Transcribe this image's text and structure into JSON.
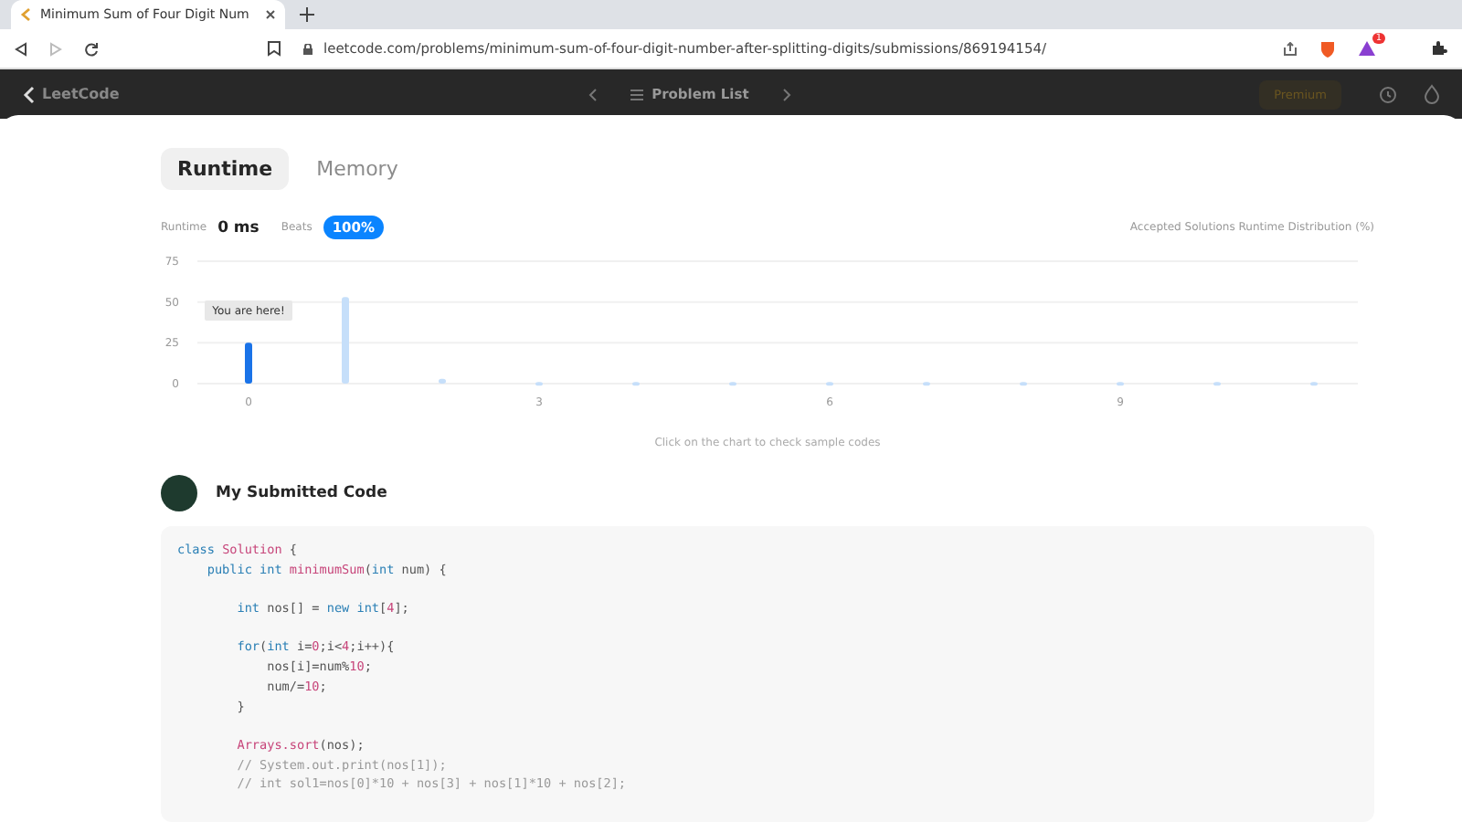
{
  "browser": {
    "tab_title": "Minimum Sum of Four Digit Num",
    "url": "leetcode.com/problems/minimum-sum-of-four-digit-number-after-splitting-digits/submissions/869194154/",
    "extension_badge": "1"
  },
  "navbar": {
    "logo": "LeetCode",
    "problem_list": "Problem List",
    "premium": "Premium"
  },
  "tabs": [
    {
      "label": "Runtime",
      "selected": true
    },
    {
      "label": "Memory",
      "selected": false
    }
  ],
  "stats": {
    "runtime_label": "Runtime",
    "runtime_value": "0 ms",
    "beats_label": "Beats",
    "beats_value": "100%",
    "distribution_title": "Accepted Solutions Runtime Distribution (%)"
  },
  "chart_data": {
    "type": "bar",
    "stacked": true,
    "categories": [
      "0",
      null,
      null,
      "3",
      null,
      null,
      "6",
      null,
      null,
      "9",
      null,
      null
    ],
    "series": [
      {
        "color": "#1a73e8",
        "values": [
          25,
          null,
          null,
          null,
          null,
          null,
          null,
          null,
          null,
          null,
          null,
          null
        ]
      },
      {
        "color": "#c6dffa",
        "values": [
          null,
          53,
          3,
          1,
          1,
          1,
          1,
          1,
          1,
          1,
          1,
          1
        ]
      }
    ],
    "ylim": [
      0,
      75
    ],
    "yticks": [
      0,
      25,
      50,
      75
    ],
    "annotations": [
      {
        "text": "You are here!"
      }
    ]
  },
  "chart_hint": "Click on the chart to check sample codes",
  "code_section": {
    "title": "My Submitted Code",
    "lines": [
      {
        "tokens": [
          {
            "kind": "keyword",
            "text": "class "
          },
          {
            "kind": "name",
            "text": "Solution"
          },
          {
            "kind": "plain",
            "text": " {"
          }
        ]
      },
      {
        "tokens": [
          {
            "kind": "keyword",
            "text": "    public int "
          },
          {
            "kind": "name",
            "text": "minimumSum"
          },
          {
            "kind": "plain",
            "text": "("
          },
          {
            "kind": "keyword",
            "text": "int"
          },
          {
            "kind": "plain",
            "text": " num) {"
          }
        ]
      },
      {
        "blank_before": true,
        "tokens": [
          {
            "kind": "keyword",
            "text": "        int"
          },
          {
            "kind": "plain",
            "text": " nos[] = "
          },
          {
            "kind": "keyword",
            "text": "new int"
          },
          {
            "kind": "plain",
            "text": "["
          },
          {
            "kind": "number",
            "text": "4"
          },
          {
            "kind": "plain",
            "text": "];"
          }
        ]
      },
      {
        "blank_before": true,
        "tokens": [
          {
            "kind": "keyword",
            "text": "        for"
          },
          {
            "kind": "plain",
            "text": "("
          },
          {
            "kind": "keyword",
            "text": "int"
          },
          {
            "kind": "plain",
            "text": " i="
          },
          {
            "kind": "number",
            "text": "0"
          },
          {
            "kind": "plain",
            "text": ";i<"
          },
          {
            "kind": "number",
            "text": "4"
          },
          {
            "kind": "plain",
            "text": ";i++){"
          }
        ]
      },
      {
        "tokens": [
          {
            "kind": "plain",
            "text": "            nos[i]=num%"
          },
          {
            "kind": "number",
            "text": "10"
          },
          {
            "kind": "plain",
            "text": ";"
          }
        ]
      },
      {
        "tokens": [
          {
            "kind": "plain",
            "text": "            num/="
          },
          {
            "kind": "number",
            "text": "10"
          },
          {
            "kind": "plain",
            "text": ";"
          }
        ]
      },
      {
        "tokens": [
          {
            "kind": "plain",
            "text": "        }"
          }
        ]
      },
      {
        "blank_before": true,
        "tokens": [
          {
            "kind": "name",
            "text": "        Arrays.sort"
          },
          {
            "kind": "plain",
            "text": "(nos);"
          }
        ]
      },
      {
        "tokens": [
          {
            "kind": "comment",
            "text": "        // System.out.print(nos[1]);"
          }
        ]
      },
      {
        "tokens": [
          {
            "kind": "comment",
            "text": "        // int sol1=nos[0]*10 + nos[3] + nos[1]*10 + nos[2];"
          }
        ]
      }
    ]
  }
}
